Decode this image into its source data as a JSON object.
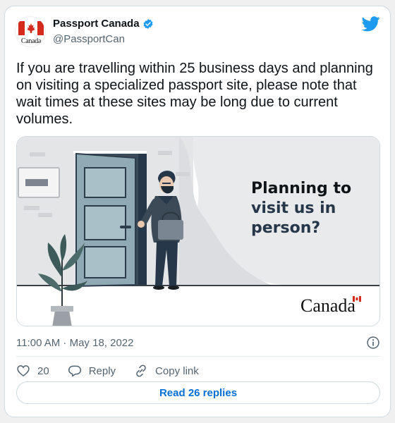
{
  "account": {
    "name": "Passport Canada",
    "handle": "@PassportCan",
    "avatar_wordmark": "Canada",
    "verified_icon": "verified-badge-icon"
  },
  "platform_icon": "bird-icon",
  "tweet": {
    "text": "If you are travelling within 25 business days and planning on visiting a specialized passport site, please note that wait times at these sites may be long due to current volumes."
  },
  "media": {
    "headline_line1": "Planning to",
    "headline_line2": "visit us in",
    "headline_line3": "person?",
    "wordmark": "Canada"
  },
  "meta": {
    "timestamp": "11:00 AM · May 18, 2022",
    "info_icon": "info-icon"
  },
  "actions": {
    "like_count": "20",
    "reply_label": "Reply",
    "copy_label": "Copy link"
  },
  "read_replies_label": "Read 26 replies",
  "colors": {
    "accent_blue": "#1d9bf0",
    "link_blue": "#006fd6",
    "headline_black": "#0f1419",
    "headline_navy": "#26374a",
    "flag_red": "#d52b1e"
  }
}
